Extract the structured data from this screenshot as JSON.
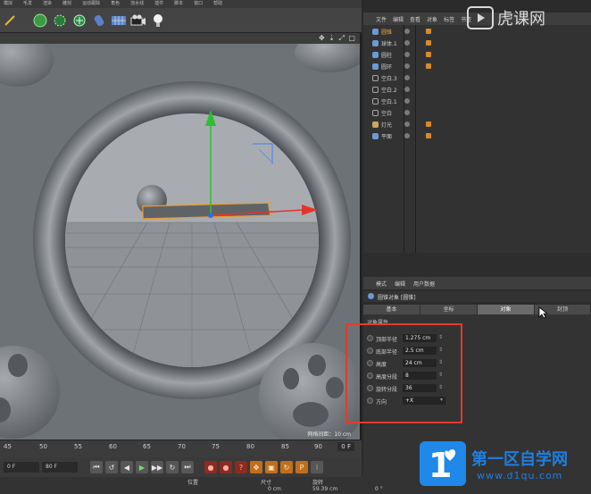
{
  "menubar": {
    "items": [
      "模拟",
      "毛发",
      "渲染",
      "雕刻",
      "运动跟踪",
      "角色",
      "流水线",
      "插件",
      "脚本",
      "窗口",
      "帮助"
    ]
  },
  "toolbar": {
    "icons": [
      "selection-tool-icon",
      "sphere-primitive-icon",
      "gear-spline-icon",
      "nurbs-icon",
      "deformer-icon",
      "floor-grid-icon",
      "camera-icon",
      "light-bulb-icon"
    ]
  },
  "viewport": {
    "nav_icons": "✥ ⇣ ⤢ ▢",
    "grid_spacing": "网格间距：10 cm"
  },
  "timeline": {
    "ticks": [
      "45",
      "50",
      "55",
      "60",
      "65",
      "70",
      "75",
      "80",
      "85",
      "90"
    ],
    "end_frame": "0 F",
    "frame_start": "0 F",
    "frame_end": "80 F"
  },
  "transport": {
    "buttons": [
      "⏮",
      "↺",
      "◀",
      "▶",
      "▶▶",
      "↻",
      "⏭"
    ]
  },
  "coords": {
    "pos_label": "位置",
    "size_label": "尺寸",
    "rot_label": "旋转",
    "x_val": "0 cm",
    "y_val": "59.39 cm",
    "rot_val": "0 °"
  },
  "object_manager": {
    "menu": [
      "文件",
      "编辑",
      "查看",
      "对象",
      "标签",
      "书签"
    ],
    "rows": [
      {
        "name": "圆锥",
        "selected": true,
        "type": "object"
      },
      {
        "name": "球体.1",
        "selected": false,
        "type": "object"
      },
      {
        "name": "圆柱",
        "selected": false,
        "type": "object"
      },
      {
        "name": "圆环",
        "selected": false,
        "type": "object"
      },
      {
        "name": "空白.3",
        "selected": false,
        "type": "null"
      },
      {
        "name": "空白.2",
        "selected": false,
        "type": "null"
      },
      {
        "name": "空白.1",
        "selected": false,
        "type": "null"
      },
      {
        "name": "空白",
        "selected": false,
        "type": "null"
      },
      {
        "name": "灯光",
        "selected": false,
        "type": "object"
      },
      {
        "name": "平面",
        "selected": false,
        "type": "object"
      }
    ]
  },
  "attributes": {
    "menu": [
      "模式",
      "编辑",
      "用户数据"
    ],
    "title": "圆锥对象 [圆锥]",
    "tabs": [
      {
        "label": "基本",
        "active": false
      },
      {
        "label": "坐标",
        "active": false
      },
      {
        "label": "对象",
        "active": true
      },
      {
        "label": "封顶",
        "active": false
      }
    ],
    "section": "对象属性",
    "properties": [
      {
        "label": "顶部半径",
        "value": "1.275 cm"
      },
      {
        "label": "底部半径",
        "value": "2.5 cm"
      },
      {
        "label": "高度",
        "value": "24 cm"
      },
      {
        "label": "高度分段",
        "value": "8"
      },
      {
        "label": "旋转分段",
        "value": "36"
      },
      {
        "label": "方向",
        "value": "+X"
      }
    ]
  },
  "watermark": {
    "top_text": "虎课网",
    "brand_name": "第一区自学网",
    "brand_url": "www.d1qu.com"
  },
  "colors": {
    "highlight": "#e23b2e",
    "brand_blue": "#1f88e8",
    "selected_orange": "#f0a640",
    "viewport_bg": "#6d7276"
  }
}
